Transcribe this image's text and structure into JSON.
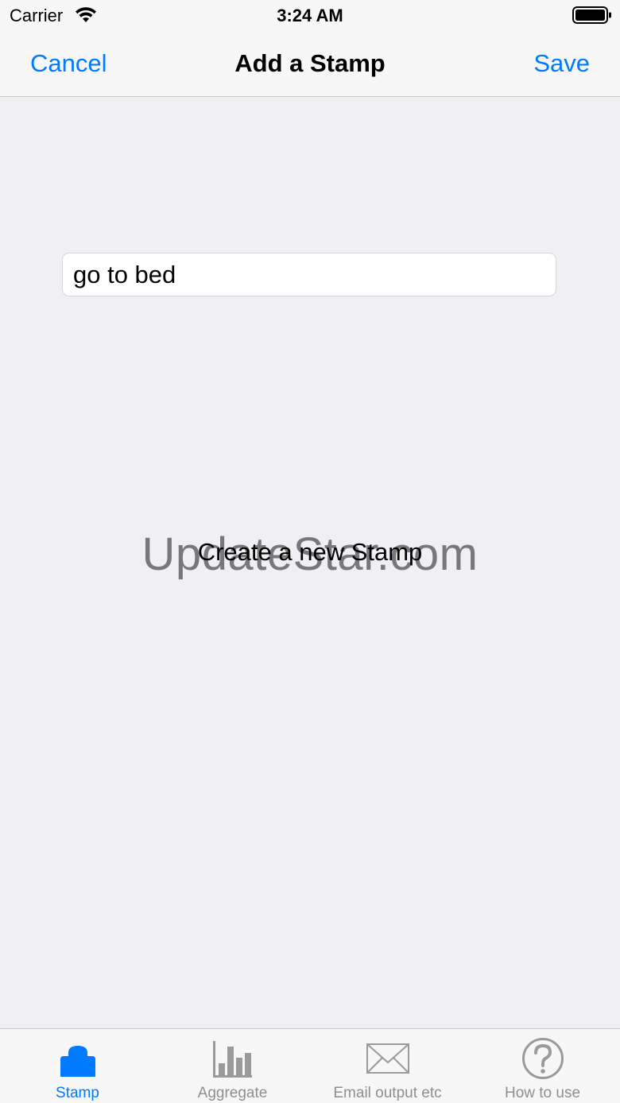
{
  "status_bar": {
    "carrier": "Carrier",
    "time": "3:24 AM",
    "wifi_icon": "wifi-icon",
    "battery_icon": "battery-icon"
  },
  "nav": {
    "cancel_label": "Cancel",
    "title": "Add a Stamp",
    "save_label": "Save"
  },
  "form": {
    "stamp_name_value": "go to bed"
  },
  "main": {
    "label": "Create a new Stamp",
    "watermark": "UpdateStar.com"
  },
  "tab_bar": {
    "tabs": [
      {
        "label": "Stamp",
        "icon": "stamp-icon",
        "active": true
      },
      {
        "label": "Aggregate",
        "icon": "bar-chart-icon",
        "active": false
      },
      {
        "label": "Email output etc",
        "icon": "envelope-icon",
        "active": false
      },
      {
        "label": "How to use",
        "icon": "question-icon",
        "active": false
      }
    ]
  },
  "colors": {
    "accent": "#007aff",
    "inactive": "#8e8e93",
    "background": "#efeff4"
  }
}
